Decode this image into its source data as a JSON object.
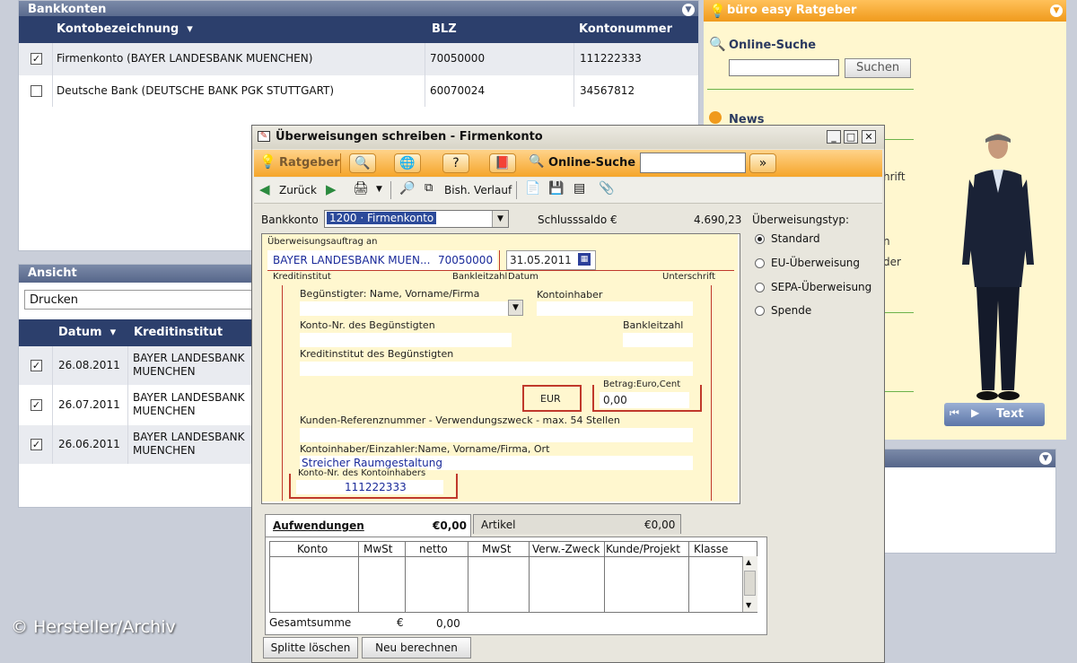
{
  "bankkonten": {
    "title": "Bankkonten",
    "columns": [
      "Kontobezeichnung",
      "BLZ",
      "Kontonummer"
    ],
    "rows": [
      {
        "checked": true,
        "name": "Firmenkonto (BAYER LANDESBANK MUENCHEN)",
        "blz": "70050000",
        "konto": "111222333"
      },
      {
        "checked": false,
        "name": "Deutsche Bank (DEUTSCHE BANK PGK STUTTGART)",
        "blz": "60070024",
        "konto": "34567812"
      }
    ]
  },
  "ansicht": {
    "title": "Ansicht",
    "select_value": "Drucken",
    "columns": [
      "Datum",
      "Kreditinstitut"
    ],
    "rows": [
      {
        "checked": true,
        "date": "26.08.2011",
        "bank1": "BAYER LANDESBANK",
        "bank2": "MUENCHEN"
      },
      {
        "checked": true,
        "date": "26.07.2011",
        "bank1": "BAYER LANDESBANK",
        "bank2": "MUENCHEN"
      },
      {
        "checked": true,
        "date": "26.06.2011",
        "bank1": "BAYER LANDESBANK",
        "bank2": "MUENCHEN"
      }
    ]
  },
  "ratgeber": {
    "title": "büro easy Ratgeber",
    "online_suche": "Online-Suche",
    "search_button": "Suchen",
    "news": "News",
    "partial1": "hrift",
    "partial2": "n",
    "partial3": "der",
    "video_text_button": "Text"
  },
  "watermark": "© Hersteller/Archiv",
  "dialog": {
    "title": "Überweisungen schreiben - Firmenkonto",
    "ratgeber_label": "Ratgeber",
    "online_suche": "Online-Suche",
    "zurueck": "Zurück",
    "bish_verlauf": "Bish. Verlauf",
    "bankkonto_label": "Bankkonto",
    "bankkonto_value": "1200 · Firmenkonto",
    "schlusssaldo_label": "Schlusssaldo €",
    "schlusssaldo_value": "4.690,23",
    "ueberweisungstyp_label": "Überweisungstyp:",
    "types": [
      "Standard",
      "EU-Überweisung",
      "SEPA-Überweisung",
      "Spende"
    ],
    "selected_type": "Standard",
    "form": {
      "auftrag_an": "Überweisungsauftrag an",
      "bank_name": "BAYER LANDESBANK MUEN...",
      "blz": "70050000",
      "datum": "31.05.2011",
      "kreditinstitut_lbl": "Kreditinstitut",
      "bankleitzahl_lbl": "Bankleitzahl",
      "datum_lbl": "Datum",
      "unterschrift_lbl": "Unterschrift",
      "beguenstigter_lbl": "Begünstigter: Name, Vorname/Firma",
      "kontoinhaber_lbl": "Kontoinhaber",
      "kontonr_beg_lbl": "Konto-Nr. des Begünstigten",
      "bankleitzahl2_lbl": "Bankleitzahl",
      "kreditinstitut_beg_lbl": "Kreditinstitut des Begünstigten",
      "currency": "EUR",
      "betrag_lbl": "Betrag:Euro,Cent",
      "betrag_value": "0,00",
      "referenz_lbl": "Kunden-Referenznummer - Verwendungszweck - max. 54 Stellen",
      "einzahler_lbl": "Kontoinhaber/Einzahler:Name, Vorname/Firma, Ort",
      "einzahler_value": "Streicher Raumgestaltung",
      "kontonr_inh_lbl": "Konto-Nr. des Kontoinhabers",
      "kontonr_inh_value": "111222333"
    },
    "tabs": [
      {
        "label": "Aufwendungen",
        "amount": "€0,00"
      },
      {
        "label": "Artikel",
        "amount": "€0,00"
      }
    ],
    "table_columns": [
      "Konto",
      "MwSt",
      "netto",
      "MwSt",
      "Verw.-Zweck",
      "Kunde/Projekt",
      "Klasse"
    ],
    "gesamtsumme_label": "Gesamtsumme",
    "gesamtsumme_currency": "€",
    "gesamtsumme_value": "0,00",
    "bottom_buttons": [
      "Splitte löschen",
      "Neu berechnen"
    ]
  }
}
